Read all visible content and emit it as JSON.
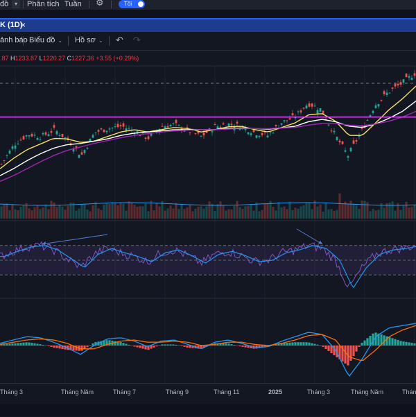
{
  "topbar": {
    "item1": "đồ",
    "caret": "▾",
    "analysis": "Phân tích",
    "week": "Tuần",
    "gear_icon": "gear-icon",
    "theme_toggle": "Tối"
  },
  "tab": {
    "label": "K (1D)",
    "close": "×"
  },
  "toolbar": {
    "alerts": "ảnh báo",
    "chart": "Biểu đồ",
    "profile": "Hồ sơ",
    "chevron": "⌄",
    "undo": "↶",
    "redo": "↷"
  },
  "ohlc": {
    "o_value": ".87",
    "h_key": "H",
    "h_value": "1233.87",
    "l_key": "L",
    "l_value": "1220.27",
    "c_key": "C",
    "c_value": "1227.36",
    "change": "+3.55 (+0.29%)"
  },
  "xaxis": {
    "labels": [
      "Tháng 3",
      "Tháng Năm",
      "Tháng 7",
      "Tháng 9",
      "Tháng 11",
      "2025",
      "Tháng 3",
      "Tháng Năm",
      "Tháng"
    ]
  },
  "colors": {
    "background": "#131722",
    "up": "#26a69a",
    "down": "#ef5350",
    "ma_fast": "#f7e05a",
    "ma_mid": "#ffffff",
    "ma_slow": "#9c27b0",
    "resistance": "#e040fb",
    "rsi": "#7e57c2",
    "rsi_ma": "#2196f3",
    "macd": "#2196f3",
    "signal": "#ff6d00",
    "accent": "#2962ff"
  },
  "chart_data": {
    "type": "line",
    "title": "",
    "x_ticks": [
      "Tháng 3",
      "Tháng Năm",
      "Tháng 7",
      "Tháng 9",
      "Tháng 11",
      "2025",
      "Tháng 3",
      "Tháng Năm",
      "Tháng"
    ],
    "ohlc_last": {
      "high": 1233.87,
      "low": 1220.27,
      "close": 1227.36,
      "change": 3.55,
      "change_pct": 0.29
    },
    "panes": [
      "price",
      "volume",
      "rsi",
      "macd"
    ],
    "series": [
      {
        "values": [
          1180,
          1215,
          1232,
          1228,
          1240,
          1222,
          1195,
          1235,
          1242,
          1246,
          1238,
          1225,
          1246,
          1249,
          1238,
          1228,
          1245,
          1250,
          1246,
          1235,
          1230,
          1252,
          1262,
          1286,
          1275,
          1232,
          1195,
          1236,
          1282,
          1305,
          1320,
          1338
        ]
      },
      {
        "values": [
          1172,
          1190,
          1205,
          1215,
          1225,
          1224,
          1218,
          1220,
          1228,
          1236,
          1240,
          1236,
          1240,
          1244,
          1242,
          1236,
          1240,
          1245,
          1246,
          1240,
          1236,
          1244,
          1252,
          1266,
          1268,
          1255,
          1230,
          1230,
          1252,
          1275,
          1294,
          1316
        ]
      },
      {
        "values": [
          1160,
          1172,
          1186,
          1198,
          1208,
          1214,
          1216,
          1220,
          1224,
          1230,
          1234,
          1236,
          1238,
          1240,
          1240,
          1240,
          1240,
          1242,
          1243,
          1242,
          1241,
          1243,
          1246,
          1254,
          1258,
          1254,
          1246,
          1244,
          1250,
          1260,
          1272,
          1290
        ]
      },
      {
        "values": [
          1150,
          1160,
          1172,
          1184,
          1195,
          1204,
          1210,
          1216,
          1221,
          1226,
          1230,
          1233,
          1236,
          1238,
          1239,
          1240,
          1240,
          1241,
          1242,
          1242,
          1242,
          1243,
          1244,
          1248,
          1251,
          1251,
          1248,
          1247,
          1250,
          1255,
          1262,
          1272
        ]
      }
    ],
    "resistance_level": 1262,
    "rsi": {
      "upper": 70,
      "lower": 30,
      "values": [
        55,
        62,
        68,
        70,
        64,
        52,
        40,
        58,
        66,
        60,
        55,
        48,
        60,
        64,
        56,
        46,
        58,
        62,
        56,
        48,
        50,
        60,
        64,
        70,
        66,
        50,
        12,
        40,
        58,
        64,
        66,
        70
      ]
    },
    "macd": {
      "macd": [
        2,
        5,
        8,
        7,
        3,
        -2,
        -8,
        0,
        6,
        7,
        4,
        -1,
        4,
        5,
        1,
        -3,
        3,
        5,
        2,
        -2,
        -1,
        4,
        8,
        12,
        10,
        -4,
        -28,
        -12,
        8,
        16,
        18,
        20
      ],
      "signal": [
        1,
        3,
        5,
        6,
        5,
        2,
        -3,
        -3,
        1,
        4,
        5,
        3,
        3,
        4,
        3,
        0,
        1,
        3,
        3,
        1,
        0,
        2,
        5,
        9,
        10,
        5,
        -10,
        -14,
        -4,
        8,
        14,
        18
      ]
    }
  }
}
